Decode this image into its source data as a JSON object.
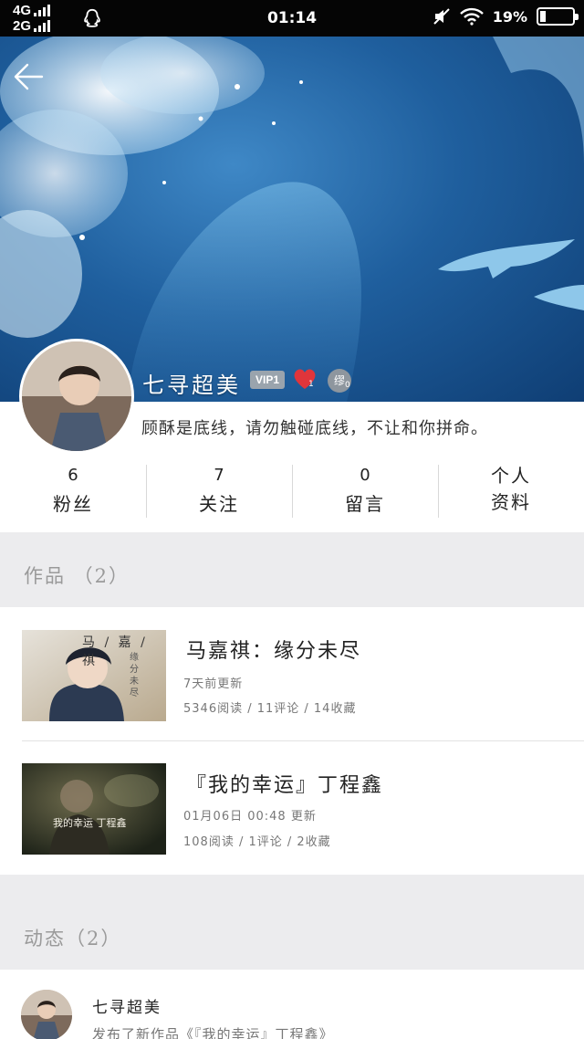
{
  "status_bar": {
    "network_top": "4G",
    "network_bottom": "2G",
    "time": "01:14",
    "battery_text": "19%",
    "battery_level": 0.19,
    "icons": [
      "signal-bars-icon",
      "qq-icon",
      "mute-icon",
      "wifi-icon",
      "battery-icon"
    ]
  },
  "header": {
    "back_icon": "back-arrow-icon",
    "banner_theme": "#2a6fae"
  },
  "profile": {
    "name": "七寻超美",
    "vip_label": "VIP1",
    "heart_count": "1",
    "medal_label": "缪",
    "medal_count": "0",
    "signature": "顾酥是底线，请勿触碰底线，不让和你拼命。"
  },
  "stats": [
    {
      "value": "6",
      "label": "粉丝"
    },
    {
      "value": "7",
      "label": "关注"
    },
    {
      "value": "0",
      "label": "留言"
    },
    {
      "value": "",
      "label": "个人资料",
      "line1": "个人",
      "line2": "资料"
    }
  ],
  "works": {
    "title": "作品 （2）",
    "items": [
      {
        "title": "马嘉祺：缘分未尽",
        "updated": "7天前更新",
        "stats": "5346阅读 / 11评论 / 14收藏",
        "cover_text_top": "马 / 嘉 / 祺",
        "cover_text_side": "缘分未尽"
      },
      {
        "title": "『我的幸运』丁程鑫",
        "updated": "01月06日 00:48 更新",
        "stats": "108阅读 / 1评论 / 2收藏",
        "cover_text": "我的幸运 丁程鑫"
      }
    ]
  },
  "feed": {
    "title": "动态（2）",
    "items": [
      {
        "name": "七寻超美",
        "text": "发布了新作品《『我的幸运』丁程鑫》"
      }
    ]
  },
  "colors": {
    "section_bg": "#ececee",
    "section_title": "#9a9a9a",
    "heart": "#e0353b"
  }
}
